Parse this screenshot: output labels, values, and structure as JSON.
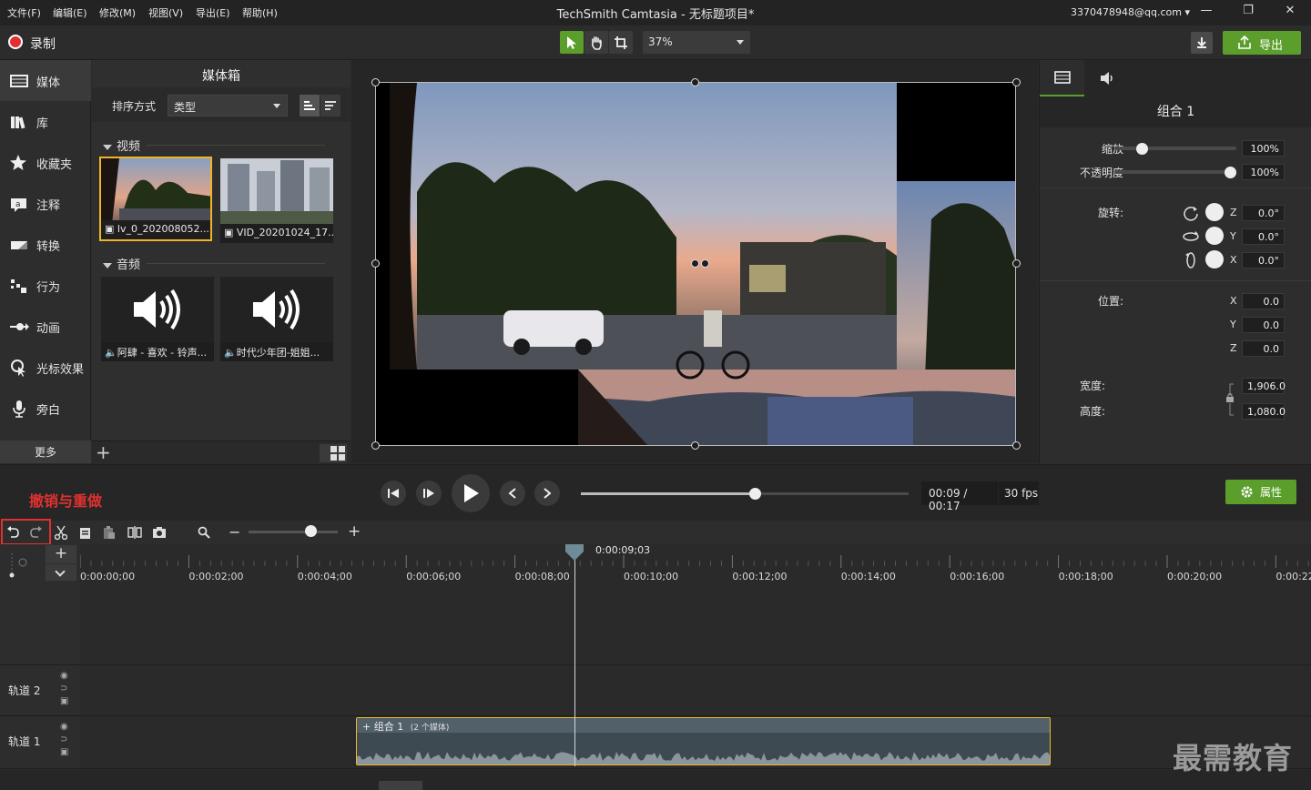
{
  "app": {
    "title": "TechSmith Camtasia - 无标题项目*",
    "account": "3370478948@qq.com",
    "menus": [
      "文件(F)",
      "编辑(E)",
      "修改(M)",
      "视图(V)",
      "导出(E)",
      "帮助(H)"
    ],
    "window_controls": [
      "minimize-icon",
      "restore-icon",
      "close-icon"
    ]
  },
  "toolbar": {
    "record_label": "录制",
    "zoom": "37%",
    "export_label": "导出",
    "tools": [
      "select-arrow-icon",
      "pan-hand-icon",
      "crop-icon"
    ]
  },
  "sidebar": {
    "items": [
      {
        "label": "媒体",
        "icon": "media-film-icon"
      },
      {
        "label": "库",
        "icon": "library-books-icon"
      },
      {
        "label": "收藏夹",
        "icon": "favorites-star-icon"
      },
      {
        "label": "注释",
        "icon": "annotation-icon"
      },
      {
        "label": "转换",
        "icon": "transition-icon"
      },
      {
        "label": "行为",
        "icon": "behavior-icon"
      },
      {
        "label": "动画",
        "icon": "animation-icon"
      },
      {
        "label": "光标效果",
        "icon": "cursor-effect-icon"
      },
      {
        "label": "旁白",
        "icon": "microphone-icon"
      }
    ],
    "more_label": "更多"
  },
  "media_bin": {
    "title": "媒体箱",
    "sort_label": "排序方式",
    "sort_value": "类型",
    "video_section": "视频",
    "audio_section": "音频",
    "videos": [
      {
        "caption": "lv_0_202008052..."
      },
      {
        "caption": "VID_20201024_17..."
      }
    ],
    "audios": [
      {
        "caption": "阿肆 - 喜欢 - 铃声..."
      },
      {
        "caption": "时代少年团-姐姐..."
      }
    ]
  },
  "properties": {
    "group_name": "组合 1",
    "scale_label": "缩放",
    "scale_value": "100%",
    "scale_level": 0.2,
    "opacity_label": "不透明度",
    "opacity_value": "100%",
    "opacity_level": 1.0,
    "rotation_label": "旋转:",
    "rotation": [
      {
        "axis": "Z",
        "value": "0.0°"
      },
      {
        "axis": "Y",
        "value": "0.0°"
      },
      {
        "axis": "X",
        "value": "0.0°"
      }
    ],
    "position_label": "位置:",
    "position": [
      {
        "axis": "X",
        "value": "0.0"
      },
      {
        "axis": "Y",
        "value": "0.0"
      },
      {
        "axis": "Z",
        "value": "0.0"
      }
    ],
    "width_label": "宽度:",
    "width_value": "1,906.0",
    "height_label": "高度:",
    "height_value": "1,080.0"
  },
  "transport": {
    "annotation": "撤销与重做",
    "time": "00:09 / 00:17",
    "fps": "30 fps",
    "progress": 0.53,
    "props_label": "属性"
  },
  "timeline": {
    "playhead_time": "0:00:09;03",
    "playhead_fraction": 0.53,
    "ticks": [
      "0:00:00;00",
      "0:00:02;00",
      "0:00:04;00",
      "0:00:06;00",
      "0:00:08;00",
      "0:00:10;00",
      "0:00:12;00",
      "0:00:14;00",
      "0:00:16;00",
      "0:00:18;00",
      "0:00:20;00",
      "0:00:22"
    ],
    "tracks": [
      {
        "name": "轨道 2"
      },
      {
        "name": "轨道 1"
      }
    ],
    "clip_label": "组合 1",
    "clip_sub": "(2 个媒体)"
  },
  "watermark": "最需教育",
  "colors": {
    "accent_green": "#5c9e2b",
    "selection_yellow": "#f0b429",
    "annotation_red": "#e03131"
  }
}
